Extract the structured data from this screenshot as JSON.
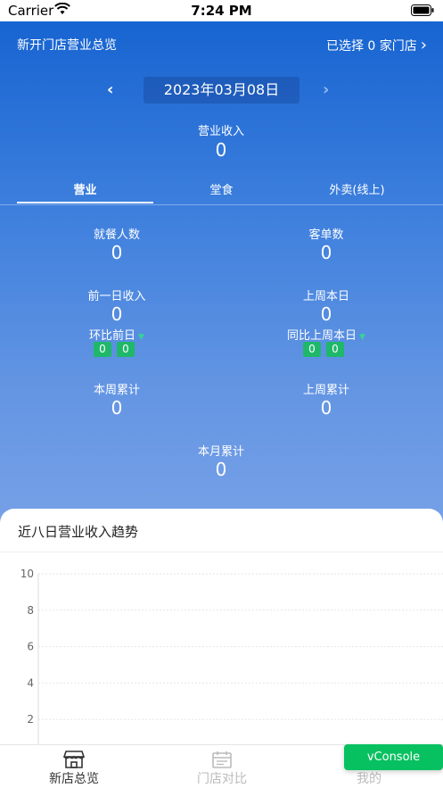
{
  "status_bar": {
    "carrier": "Carrier",
    "time": "7:24 PM"
  },
  "header": {
    "title": "新开门店营业总览",
    "store_select_label": "已选择 0 家门店",
    "chevron": "›"
  },
  "date_nav": {
    "prev_symbol": "‹",
    "date": "2023年03月08日",
    "next_symbol": "›"
  },
  "revenue": {
    "label": "营业收入",
    "value": "0"
  },
  "tabs": [
    {
      "label": "营业",
      "active": true
    },
    {
      "label": "堂食",
      "active": false
    },
    {
      "label": "外卖(线上)",
      "active": false
    }
  ],
  "metrics": {
    "diners": {
      "label": "就餐人数",
      "value": "0"
    },
    "avg_ticket": {
      "label": "客单数",
      "value": "0"
    },
    "prev_day_revenue": {
      "label": "前一日收入",
      "value": "0"
    },
    "last_week_same_day": {
      "label": "上周本日",
      "value": "0"
    },
    "week_total": {
      "label": "本周累计",
      "value": "0"
    },
    "last_week_total": {
      "label": "上周累计",
      "value": "0"
    },
    "month_total": {
      "label": "本月累计",
      "value": "0"
    }
  },
  "comparisons": {
    "day_over_day": {
      "label": "环比前日",
      "arrow": "▼",
      "badges": [
        "0",
        "0"
      ]
    },
    "week_over_week": {
      "label": "同比上周本日",
      "arrow": "▼",
      "badges": [
        "0",
        "0"
      ]
    }
  },
  "trend_card": {
    "title": "近八日营业收入趋势"
  },
  "chart_data": {
    "type": "line",
    "title": "近八日营业收入趋势",
    "xlabel": "",
    "ylabel": "",
    "ylim": [
      0,
      10
    ],
    "y_ticks": [
      "10",
      "8",
      "6",
      "4",
      "2"
    ],
    "grid": true,
    "series": []
  },
  "tabbar": [
    {
      "label": "新店总览",
      "icon": "store-icon",
      "active": true
    },
    {
      "label": "门店对比",
      "icon": "calendar-icon",
      "active": false
    },
    {
      "label": "我的",
      "icon": "user-icon",
      "active": false
    }
  ],
  "vconsole": {
    "label": "vConsole"
  },
  "colors": {
    "primary": "#1764d1",
    "badge_green": "#1fb86a",
    "vconsole_green": "#07c160"
  }
}
